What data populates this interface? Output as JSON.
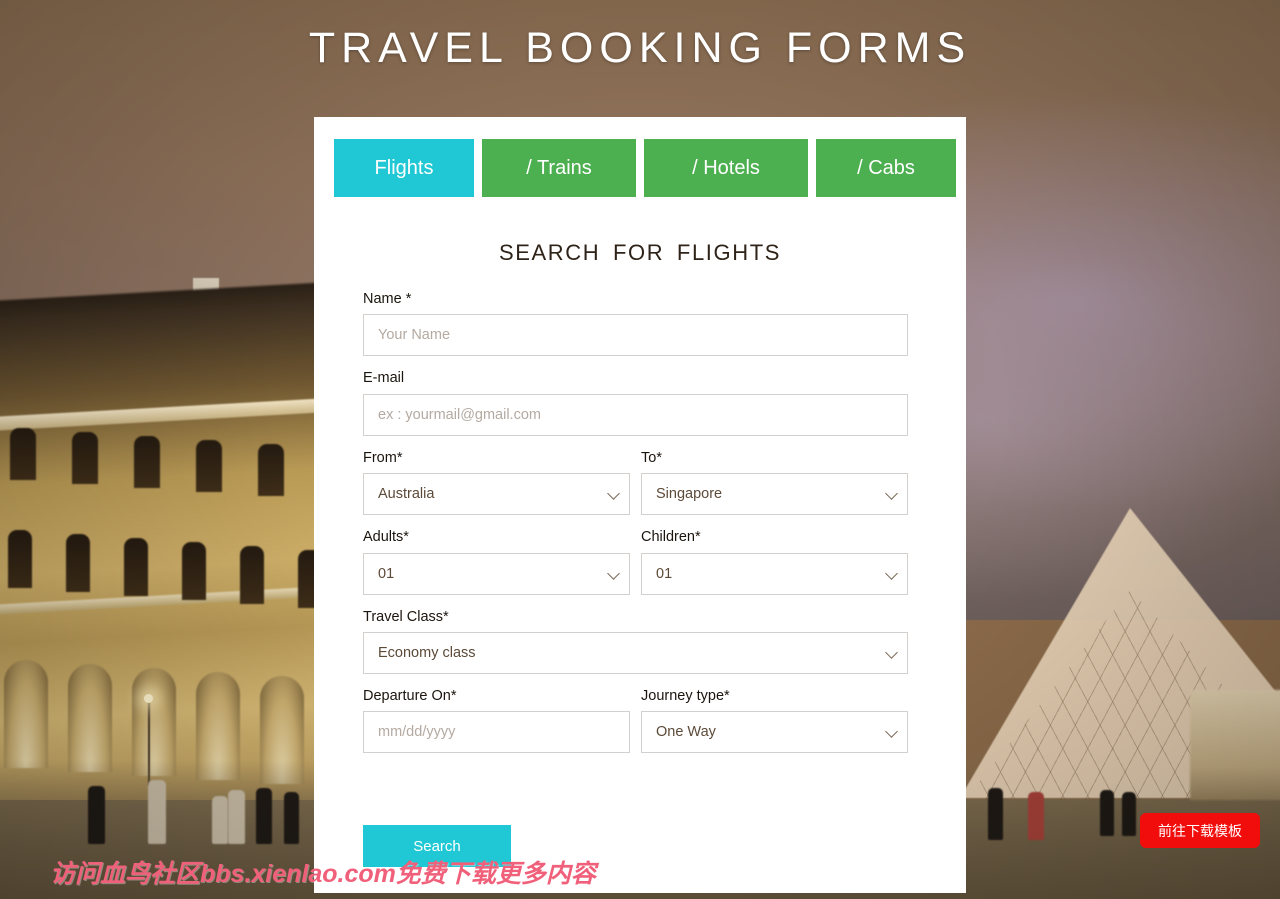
{
  "page": {
    "title": "TRAVEL BOOKING FORMS"
  },
  "tabs": [
    {
      "label": "Flights",
      "active": true
    },
    {
      "label": "/ Trains",
      "active": false
    },
    {
      "label": "/ Hotels",
      "active": false
    },
    {
      "label": "/ Cabs",
      "active": false
    }
  ],
  "form": {
    "heading": "SEARCH  FOR  FLIGHTS",
    "name": {
      "label": "Name *",
      "placeholder": "Your Name",
      "value": ""
    },
    "email": {
      "label": "E-mail",
      "placeholder": "ex : yourmail@gmail.com",
      "value": ""
    },
    "from": {
      "label": "From*",
      "value": "Australia"
    },
    "to": {
      "label": "To*",
      "value": "Singapore"
    },
    "adults": {
      "label": "Adults*",
      "value": "01"
    },
    "children": {
      "label": "Children*",
      "value": "01"
    },
    "travel_class": {
      "label": "Travel Class*",
      "value": "Economy class"
    },
    "departure": {
      "label": "Departure On*",
      "placeholder": "mm/dd/yyyy",
      "value": ""
    },
    "journey_type": {
      "label": "Journey type*",
      "value": "One Way"
    },
    "submit_label": "Search"
  },
  "overlays": {
    "watermark_text": "访问血鸟社区bbs.xienlao.com免费下载更多内容",
    "download_badge_label": "前往下载模板"
  },
  "colors": {
    "tab_active": "#1fc8d4",
    "tab_inactive": "#4caf50",
    "card_background": "#ffffff",
    "submit_button": "#1fc8d4",
    "badge_red": "#f20d0d",
    "watermark_pink": "#f0607a",
    "label_text": "#1c150e",
    "value_text": "#5c4a38",
    "placeholder_text": "#b4aaa1",
    "field_border": "#d3d0cd"
  }
}
